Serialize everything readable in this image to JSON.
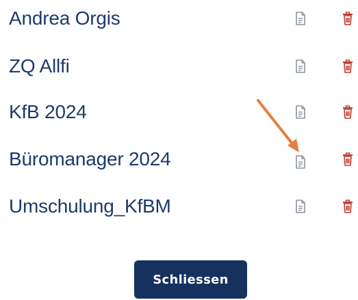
{
  "list": {
    "items": [
      {
        "label": "Andrea Orgis",
        "doc_icon": "document-icon",
        "delete_icon": "trash-icon"
      },
      {
        "label": "ZQ Allfi",
        "doc_icon": "document-icon",
        "delete_icon": "trash-icon"
      },
      {
        "label": "KfB 2024",
        "doc_icon": "document-icon",
        "delete_icon": "trash-icon"
      },
      {
        "label": "Büromanager 2024",
        "doc_icon": "document-icon",
        "delete_icon": "trash-icon"
      },
      {
        "label": "Umschulung_KfBM",
        "doc_icon": "document-icon",
        "delete_icon": "trash-icon"
      }
    ]
  },
  "footer": {
    "close_label": "Schliessen"
  },
  "colors": {
    "label_text": "#1d3a6b",
    "doc_icon": "#8a93a0",
    "delete_icon": "#c0392b",
    "button_bg": "#15315e",
    "button_text": "#ffffff",
    "annotation_arrow": "#e87d3e"
  }
}
